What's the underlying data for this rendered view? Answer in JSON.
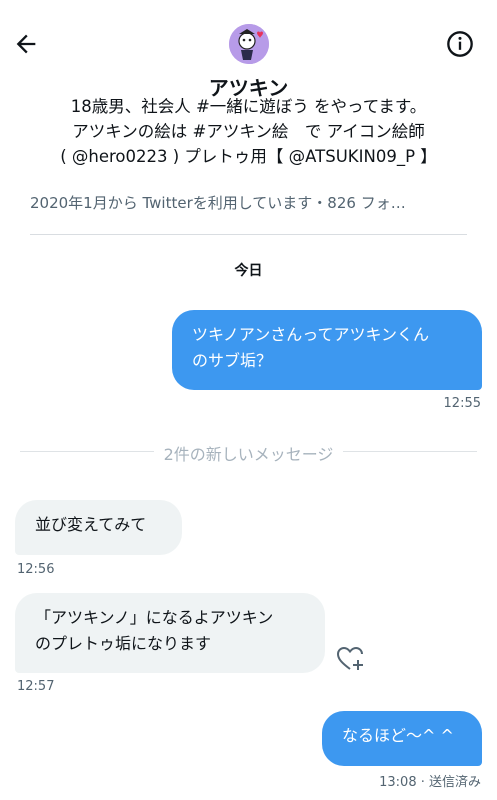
{
  "header": {
    "back_icon": "arrow-left-icon",
    "info_icon": "info-circle-icon"
  },
  "profile": {
    "name": "アツキン",
    "bio": "18歳男、社会人 #一緒に遊ぼう をやってます。\nアツキンの絵は #アツキン絵　で アイコン絵師\n( @hero0223 ) プレトゥ用【 @ATSUKIN09_P 】",
    "meta": "2020年1月から Twitterを利用しています・826 フォ…"
  },
  "conversation": {
    "date_separator": "今日",
    "new_messages_label": "2件の新しいメッセージ",
    "messages": [
      {
        "direction": "out",
        "text": "ツキノアンさんってアツキンくん\nのサブ垢？",
        "time": "12:55"
      },
      {
        "direction": "in",
        "text": "並び変えてみて",
        "time": "12:56"
      },
      {
        "direction": "in",
        "text": "「アツキンノ」になるよアツキン\nのプレトゥ垢になります",
        "time": "12:57"
      },
      {
        "direction": "out",
        "text": "なるほど〜^ ^",
        "time": "13:08 · 送信済み"
      }
    ]
  },
  "colors": {
    "outgoing_bubble": "#3d98f0",
    "incoming_bubble": "#eff3f4",
    "secondary_text": "#536471"
  }
}
